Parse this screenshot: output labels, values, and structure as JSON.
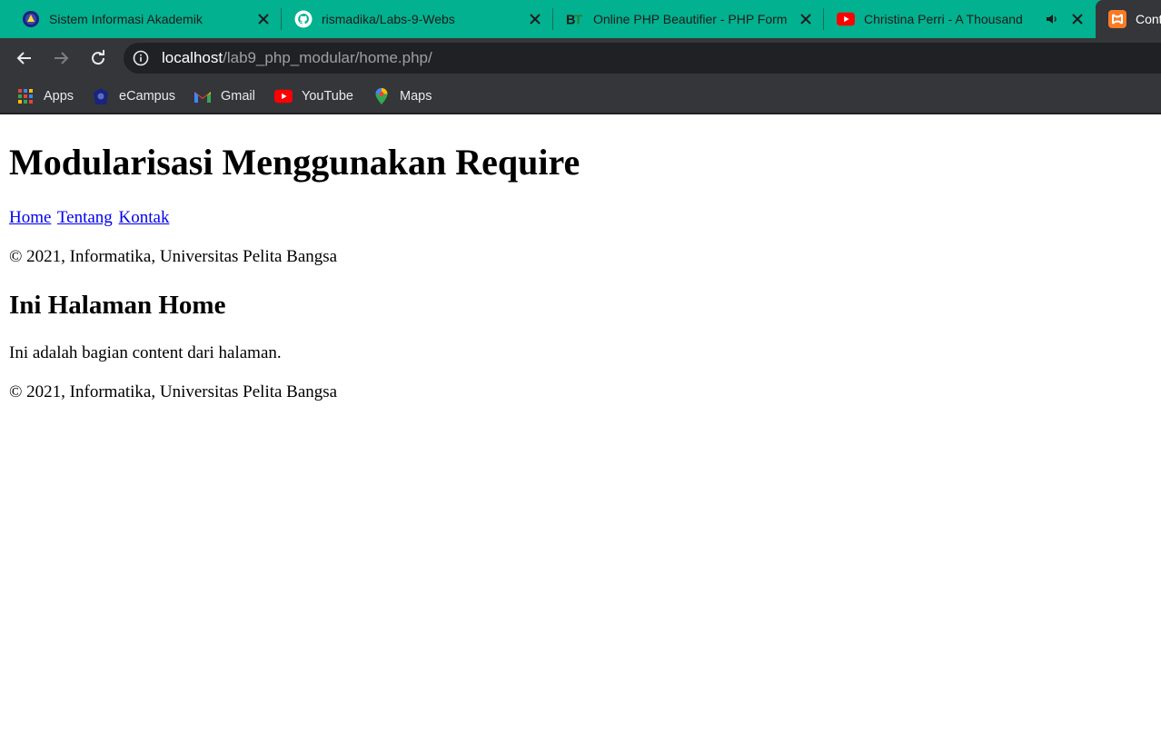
{
  "browser": {
    "tabs": [
      {
        "title": "Sistem Informasi Akademik",
        "icon": "university-logo-icon"
      },
      {
        "title": "rismadika/Labs-9-Webs",
        "icon": "github-icon"
      },
      {
        "title": "Online PHP Beautifier - PHP Form",
        "icon": "beautifier-bt-icon"
      },
      {
        "title": "Christina Perri - A Thousand",
        "icon": "youtube-icon",
        "audio": "speaker-icon"
      },
      {
        "title": "Cont",
        "icon": "xampp-icon"
      }
    ],
    "address": {
      "host": "localhost",
      "path": "/lab9_php_modular/home.php/"
    },
    "bookmarks": [
      {
        "label": "Apps",
        "icon": "apps-grid-icon"
      },
      {
        "label": "eCampus",
        "icon": "university-logo-icon"
      },
      {
        "label": "Gmail",
        "icon": "gmail-icon"
      },
      {
        "label": "YouTube",
        "icon": "youtube-icon"
      },
      {
        "label": "Maps",
        "icon": "maps-pin-icon"
      }
    ],
    "colors": {
      "tab_strip": "#02b18f",
      "toolbar": "#35363a",
      "omnibox": "#202124"
    }
  },
  "page": {
    "heading": "Modularisasi Menggunakan Require",
    "nav": [
      "Home",
      "Tentang",
      "Kontak"
    ],
    "footer_top": "© 2021, Informatika, Universitas Pelita Bangsa",
    "subheading": "Ini Halaman Home",
    "content": "Ini adalah bagian content dari halaman.",
    "footer_bottom": "© 2021, Informatika, Universitas Pelita Bangsa",
    "link_color": "#0000ee"
  }
}
